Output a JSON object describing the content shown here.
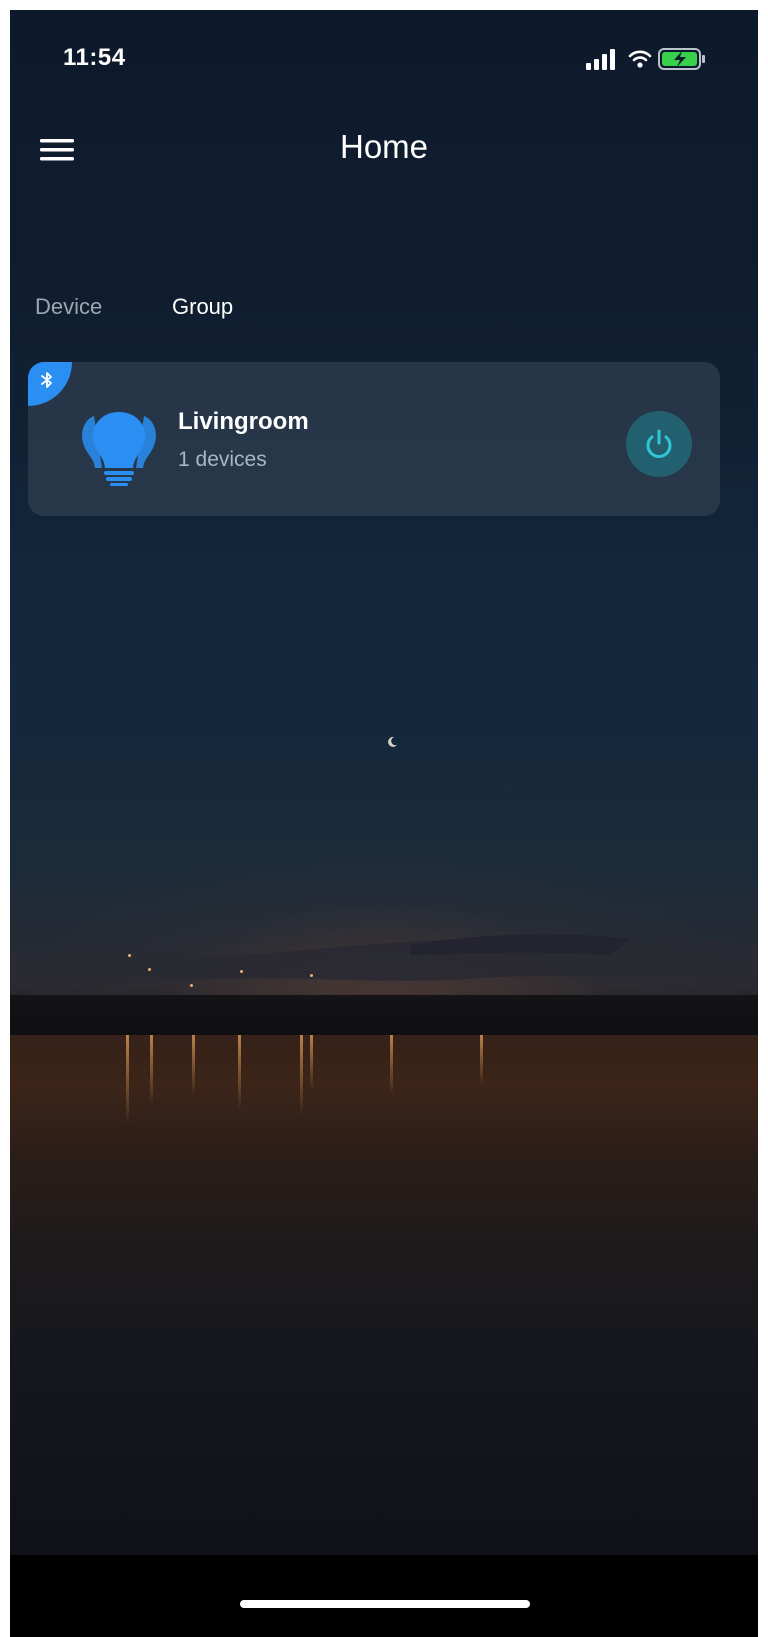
{
  "status_bar": {
    "time": "11:54",
    "icons": [
      "signal-icon",
      "wifi-icon",
      "battery-charging-icon"
    ]
  },
  "header": {
    "title": "Home",
    "menu_icon": "hamburger-menu-icon"
  },
  "tabs": [
    {
      "label": "Device",
      "selected": false
    },
    {
      "label": "Group",
      "selected": true
    }
  ],
  "groups": [
    {
      "name": "Livingroom",
      "device_count": "1 devices",
      "icon": "bulb-group-icon",
      "badge_icon": "bluetooth-icon",
      "power_icon": "power-icon"
    }
  ],
  "colors": {
    "accent_blue": "#2a8ef2",
    "power_button_bg": "#23606f",
    "power_icon": "#2fc7d6",
    "tab_inactive": "#9aa6b2",
    "text_primary": "#ffffff"
  },
  "background": "night-lake-sunset-icon"
}
